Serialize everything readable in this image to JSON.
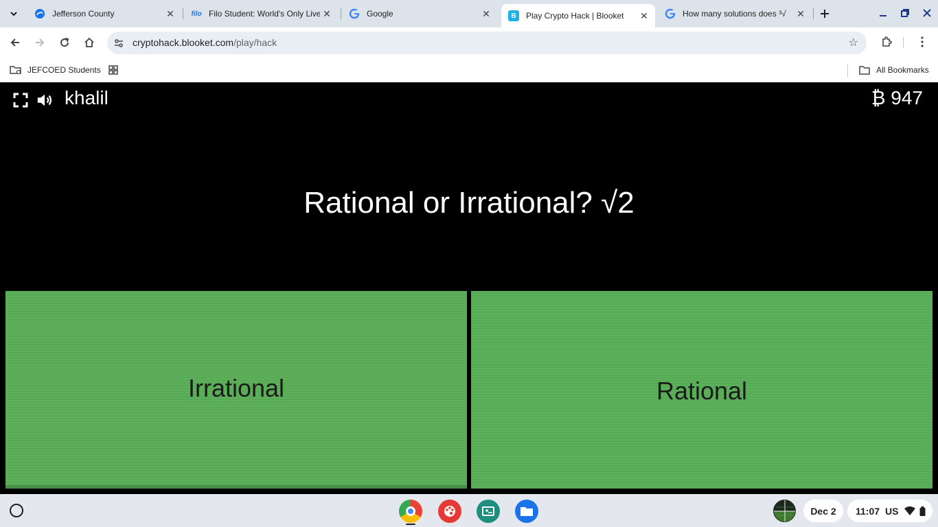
{
  "browser": {
    "tabs": [
      {
        "title": "Jefferson County",
        "favicon": "cloud-icon",
        "color": "#1a73e8"
      },
      {
        "title": "Filo Student: World's Only Live",
        "favicon": "filo-icon",
        "color": "#1a73e8"
      },
      {
        "title": "Google",
        "favicon": "google-icon",
        "color": "#4285f4"
      },
      {
        "title": "Play Crypto Hack | Blooket",
        "favicon": "blooket-icon",
        "color": "#1eb0e6",
        "active": true
      },
      {
        "title": "How many solutions does ³√",
        "favicon": "google-icon",
        "color": "#4285f4"
      }
    ],
    "filo_favicon_text": "filo",
    "blooket_favicon_text": "B",
    "url_domain": "cryptohack.blooket.com",
    "url_path": "/play/hack",
    "bookmarks": {
      "folder": "JEFCOED Students",
      "all": "All Bookmarks"
    }
  },
  "game": {
    "username": "khalil",
    "currency_symbol": "₿",
    "balance": "947",
    "question": "Rational or Irrational? √2",
    "answers": [
      "Irrational",
      "Rational"
    ],
    "answer_color": "#5db15b"
  },
  "shelf": {
    "date": "Dec 2",
    "time": "11:07",
    "locale": "US",
    "apps": [
      "chrome-icon",
      "canvas-paint-icon",
      "classroom-icon",
      "files-icon"
    ]
  }
}
